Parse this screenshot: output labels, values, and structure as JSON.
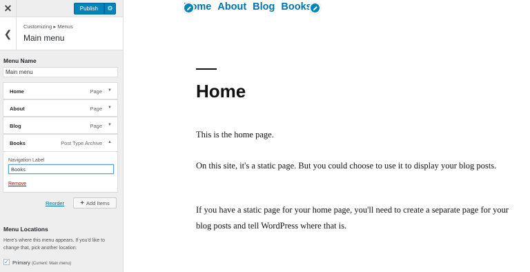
{
  "topbar": {
    "close_glyph": "✕",
    "publish_label": "Publish",
    "settings_icon": "gear-icon"
  },
  "section": {
    "breadcrumb": "Customizing ▸ Menus",
    "title": "Main menu",
    "back_icon": "chevron-left-icon"
  },
  "menu_name": {
    "label": "Menu Name",
    "value": "Main menu"
  },
  "menu_items": [
    {
      "title": "Home",
      "type": "Page",
      "expanded": false
    },
    {
      "title": "About",
      "type": "Page",
      "expanded": false
    },
    {
      "title": "Blog",
      "type": "Page",
      "expanded": false
    },
    {
      "title": "Books",
      "type": "Post Type Archive",
      "expanded": true
    }
  ],
  "expanded_item": {
    "nav_label_caption": "Navigation Label",
    "nav_label_value": "Books",
    "remove_label": "Remove"
  },
  "actions": {
    "reorder_label": "Reorder",
    "add_items_label": "Add Items"
  },
  "locations": {
    "title": "Menu Locations",
    "description": "Here's where this menu appears. If you'd like to change that, pick another location.",
    "primary_label": "Primary",
    "primary_current": "(Current: Main menu)",
    "primary_checked": true
  },
  "preview": {
    "nav": [
      "Home",
      "About",
      "Blog",
      "Books"
    ],
    "page_title": "Home",
    "paragraphs": [
      "This is the home page.",
      "On this site, it's a static page. But you could choose to use it to display your blog posts.",
      "If you have a static page for your home page, you'll need to create a separate page for your blog posts and tell WordPress where that is."
    ]
  },
  "colors": {
    "accent": "#0085ba",
    "link": "#0073aa",
    "remove": "#aa0000"
  }
}
